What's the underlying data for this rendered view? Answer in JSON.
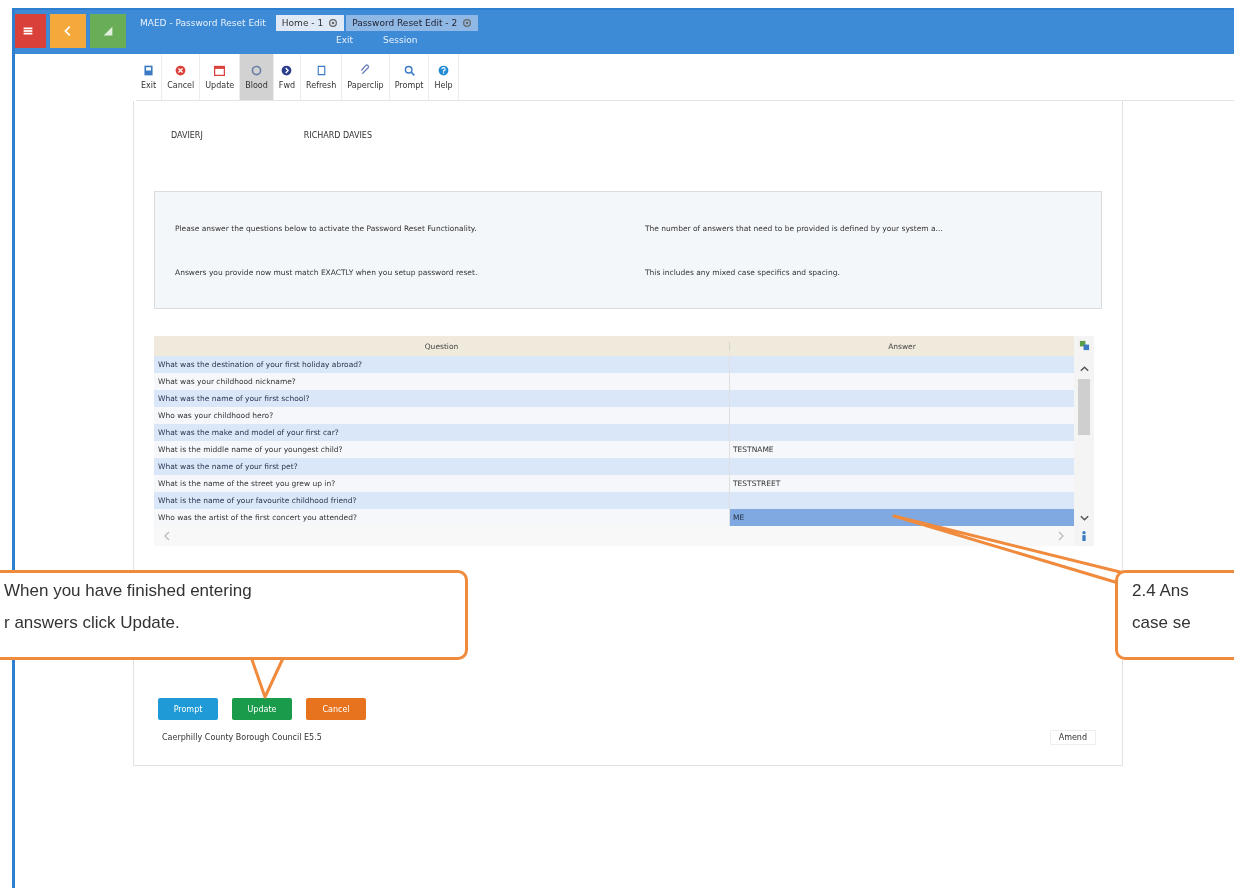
{
  "window": {
    "title": "MAED - Password Reset Edit"
  },
  "app_buttons": [
    {
      "kind": "menu",
      "color": "#d9403a"
    },
    {
      "kind": "back",
      "color": "#f4a93a"
    },
    {
      "kind": "signal",
      "color": "#6aad57"
    }
  ],
  "tabs": [
    {
      "label": "Home - 1",
      "selected": false
    },
    {
      "label": "Password Reset Edit - 2",
      "selected": true
    }
  ],
  "menu": [
    "Exit",
    "Session"
  ],
  "toolbar": [
    {
      "label": "Exit",
      "kind": "exit",
      "pressed": false
    },
    {
      "label": "Cancel",
      "kind": "cancel",
      "pressed": false
    },
    {
      "label": "Update",
      "kind": "update",
      "pressed": false
    },
    {
      "label": "Blood",
      "kind": "blood",
      "pressed": true
    },
    {
      "label": "Fwd",
      "kind": "fwd",
      "pressed": false
    },
    {
      "label": "Refresh",
      "kind": "refresh",
      "pressed": false
    },
    {
      "label": "Paperclip",
      "kind": "paperclip",
      "pressed": false
    },
    {
      "label": "Prompt",
      "kind": "prompt",
      "pressed": false
    },
    {
      "label": "Help",
      "kind": "help",
      "pressed": false
    }
  ],
  "user": {
    "code": "DAVIERJ",
    "name": "RICHARD DAVIES"
  },
  "info": [
    [
      "Please answer the questions below to activate the Password Reset Functionality.",
      "The number of answers that need to be provided is defined by your system a..."
    ],
    [
      "Answers you provide now must match EXACTLY when you setup password reset.",
      "This includes any mixed case specifics and spacing."
    ]
  ],
  "table": {
    "columns": [
      "Question",
      "Answer"
    ],
    "rows": [
      {
        "question": "What was the destination of your first holiday abroad?",
        "answer": "",
        "selected": false
      },
      {
        "question": "What was your childhood nickname?",
        "answer": "",
        "selected": false
      },
      {
        "question": "What was the name of your first school?",
        "answer": "",
        "selected": false
      },
      {
        "question": "Who was your childhood hero?",
        "answer": "",
        "selected": false
      },
      {
        "question": "What was the make and model of your first car?",
        "answer": "",
        "selected": false
      },
      {
        "question": "What is the middle name of your youngest child?",
        "answer": "TESTNAME",
        "selected": false
      },
      {
        "question": "What was the name of your first pet?",
        "answer": "",
        "selected": false
      },
      {
        "question": "What is the name of the street you grew up in?",
        "answer": "TESTSTREET",
        "selected": false
      },
      {
        "question": "What is the name of your favourite childhood friend?",
        "answer": "",
        "selected": false
      },
      {
        "question": "Who was the artist of the first concert you attended?",
        "answer": "ME",
        "selected": true
      }
    ]
  },
  "buttons": [
    {
      "label": "Prompt",
      "color": "#1f9ad6"
    },
    {
      "label": "Update",
      "color": "#1a9a4b"
    },
    {
      "label": "Cancel",
      "color": "#e8731e"
    }
  ],
  "footer": {
    "text": "Caerphilly County Borough Council E5.5",
    "mode": "Amend"
  },
  "callouts": [
    {
      "kind": "left",
      "lines": [
        "When you have finished entering",
        "r answers click Update."
      ]
    },
    {
      "kind": "right",
      "lines": [
        "2.4 Ans",
        "case se"
      ]
    }
  ]
}
